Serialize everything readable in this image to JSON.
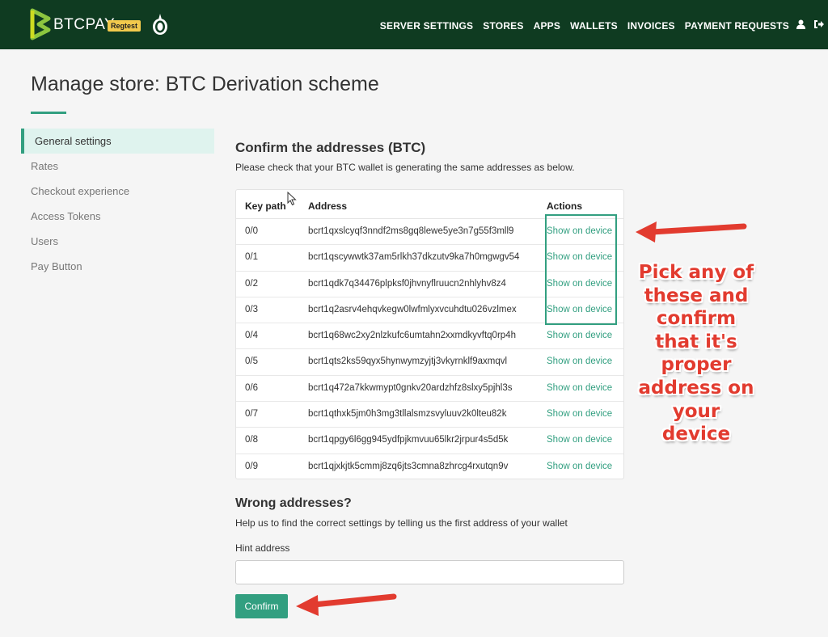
{
  "navbar": {
    "brand": "BTCPAY",
    "env_badge": "Regtest",
    "links": [
      "SERVER SETTINGS",
      "STORES",
      "APPS",
      "WALLETS",
      "INVOICES",
      "PAYMENT REQUESTS"
    ],
    "icons": [
      "user-icon",
      "logout-icon"
    ]
  },
  "page": {
    "title": "Manage store: BTC Derivation scheme"
  },
  "sidebar": {
    "items": [
      {
        "label": "General settings",
        "active": true
      },
      {
        "label": "Rates"
      },
      {
        "label": "Checkout experience"
      },
      {
        "label": "Access Tokens"
      },
      {
        "label": "Users"
      },
      {
        "label": "Pay Button"
      }
    ]
  },
  "confirm": {
    "title": "Confirm the addresses (BTC)",
    "description": "Please check that your BTC wallet is generating the same addresses as below.",
    "columns": {
      "path": "Key path",
      "address": "Address",
      "actions": "Actions"
    },
    "rows": [
      {
        "path": "0/0",
        "address": "bcrt1qxslcyqf3nndf2ms8gq8lewe5ye3n7g55f3mll9",
        "action": "Show on device"
      },
      {
        "path": "0/1",
        "address": "bcrt1qscywwtk37am5rlkh37dkzutv9ka7h0mgwgv54",
        "action": "Show on device"
      },
      {
        "path": "0/2",
        "address": "bcrt1qdk7q34476plpksf0jhvnyflruucn2nhlyhv8z4",
        "action": "Show on device"
      },
      {
        "path": "0/3",
        "address": "bcrt1q2asrv4ehqvkegw0lwfmlyxvcuhdtu026vzlmex",
        "action": "Show on device"
      },
      {
        "path": "0/4",
        "address": "bcrt1q68wc2xy2nlzkufc6umtahn2xxmdkyvftq0rp4h",
        "action": "Show on device"
      },
      {
        "path": "0/5",
        "address": "bcrt1qts2ks59qyx5hynwymzyjtj3vkyrnklf9axmqvl",
        "action": "Show on device"
      },
      {
        "path": "0/6",
        "address": "bcrt1q472a7kkwmypt0gnkv20ardzhfz8slxy5pjhl3s",
        "action": "Show on device"
      },
      {
        "path": "0/7",
        "address": "bcrt1qthxk5jm0h3mg3tllalsmzsvyluuv2k0lteu82k",
        "action": "Show on device"
      },
      {
        "path": "0/8",
        "address": "bcrt1qpgy6l6gg945ydfpjkmvuu65lkr2jrpur4s5d5k",
        "action": "Show on device"
      },
      {
        "path": "0/9",
        "address": "bcrt1qjxkjtk5cmmj8zq6jts3cmna8zhrcg4rxutqn9v",
        "action": "Show on device"
      }
    ]
  },
  "wrong": {
    "title": "Wrong addresses?",
    "description": "Help us to find the correct settings by telling us the first address of your wallet",
    "hint_label": "Hint address",
    "hint_value": "",
    "confirm_label": "Confirm"
  },
  "annotation": {
    "lines": [
      "Pick any of",
      "these and",
      "confirm",
      "that it's",
      "proper",
      "address on",
      "your",
      "device"
    ],
    "color": "#e23b2f"
  },
  "colors": {
    "navbar_bg": "#0f3b21",
    "accent": "#329f80",
    "annotation": "#e23b2f"
  }
}
